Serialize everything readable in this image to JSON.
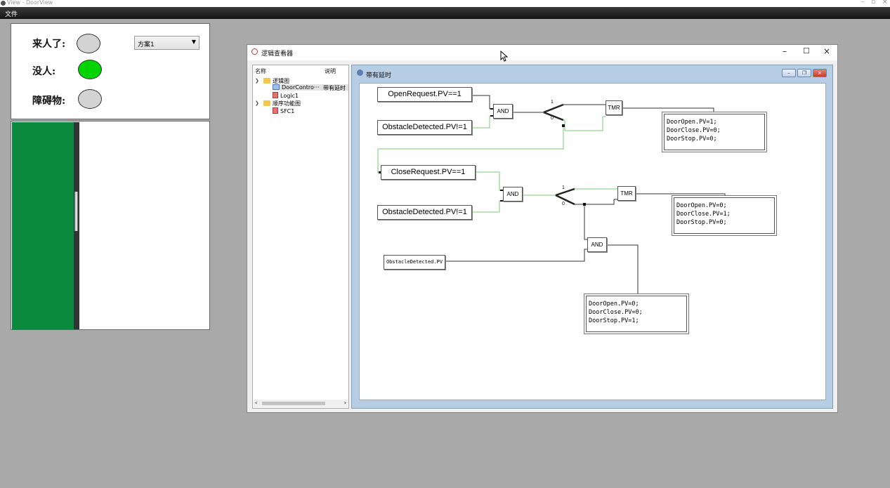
{
  "app": {
    "title": "View - DoorView",
    "menu": [
      "文件"
    ]
  },
  "status_panel": {
    "rows": [
      {
        "label": "来人了:",
        "lamp_color": "#d3d3d3"
      },
      {
        "label": "没人:",
        "lamp_color": "#00d400"
      },
      {
        "label": "障碍物:",
        "lamp_color": "#d3d3d3"
      }
    ],
    "scheme_select": {
      "value": "方案1"
    }
  },
  "door": {
    "door_color": "#0b8a3e"
  },
  "logic_viewer": {
    "title": "逻辑查看器",
    "tree": {
      "columns": [
        "名称",
        "说明"
      ],
      "items": [
        {
          "label": "逻辑图"
        },
        {
          "label": "DoorContro···",
          "desc": "带有延时"
        },
        {
          "label": "Logic1"
        },
        {
          "label": "顺序功能图"
        },
        {
          "label": "SFC1"
        }
      ]
    },
    "diagram": {
      "title": "带有延时",
      "conditions": {
        "c1": "OpenRequest.PV==1",
        "c2": "ObstacleDetected.PV!=1",
        "c3": "CloseRequest.PV==1",
        "c4": "ObstacleDetected.PV!=1",
        "c5": "ObstacleDetected.PV"
      },
      "gates": {
        "g1": "AND",
        "g2": "AND",
        "g3": "AND",
        "t1": "TMR",
        "t2": "TMR"
      },
      "switch_labels": {
        "one": "1",
        "zero": "0"
      },
      "actions": {
        "a1": [
          "DoorOpen.PV=1;",
          "DoorClose.PV=0;",
          "DoorStop.PV=0;"
        ],
        "a2": [
          "DoorOpen.PV=0;",
          "DoorClose.PV=1;",
          "DoorStop.PV=0;"
        ],
        "a3": [
          "DoorOpen.PV=0;",
          "DoorClose.PV=0;",
          "DoorStop.PV=1;"
        ]
      }
    }
  }
}
